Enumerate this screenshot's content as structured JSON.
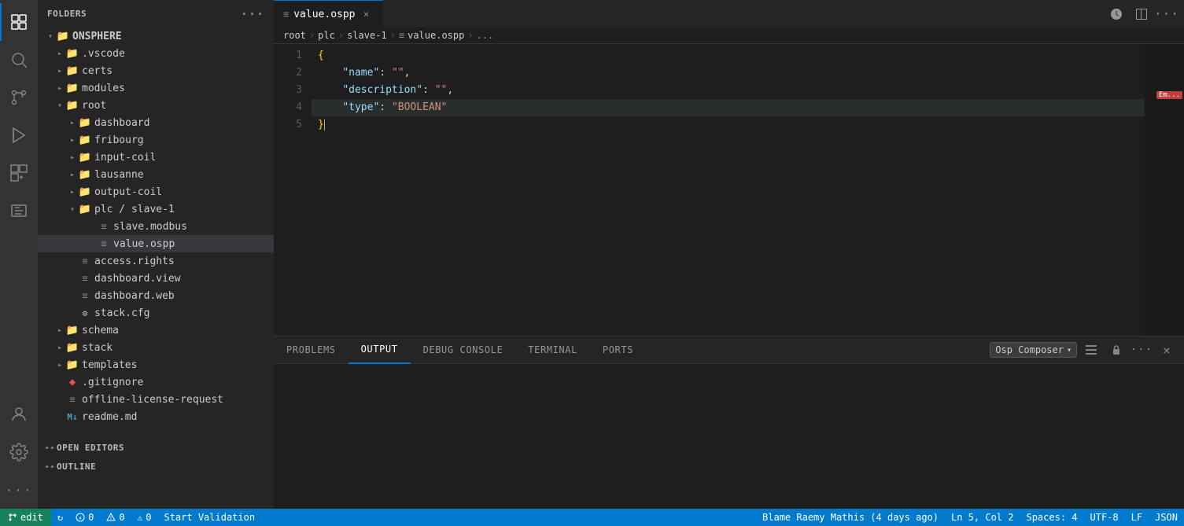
{
  "sidebar": {
    "title": "FOLDERS",
    "root_folder": "ONSPHERE",
    "items": [
      {
        "id": "vscode",
        "label": ".vscode",
        "type": "folder",
        "indent": 1,
        "open": false
      },
      {
        "id": "certs",
        "label": "certs",
        "type": "folder",
        "indent": 1,
        "open": false
      },
      {
        "id": "modules",
        "label": "modules",
        "type": "folder",
        "indent": 1,
        "open": false
      },
      {
        "id": "root",
        "label": "root",
        "type": "folder",
        "indent": 1,
        "open": true
      },
      {
        "id": "dashboard",
        "label": "dashboard",
        "type": "folder",
        "indent": 2,
        "open": false
      },
      {
        "id": "fribourg",
        "label": "fribourg",
        "type": "folder",
        "indent": 2,
        "open": false
      },
      {
        "id": "input-coil",
        "label": "input-coil",
        "type": "folder",
        "indent": 2,
        "open": false
      },
      {
        "id": "lausanne",
        "label": "lausanne",
        "type": "folder",
        "indent": 2,
        "open": false
      },
      {
        "id": "output-coil",
        "label": "output-coil",
        "type": "folder",
        "indent": 2,
        "open": false
      },
      {
        "id": "plc-slave-1",
        "label": "plc / slave-1",
        "type": "folder",
        "indent": 2,
        "open": true
      },
      {
        "id": "slave-modbus",
        "label": "slave.modbus",
        "type": "file-lines",
        "indent": 3,
        "open": false
      },
      {
        "id": "value-ospp",
        "label": "value.ospp",
        "type": "file-lines",
        "indent": 3,
        "open": false,
        "selected": true
      },
      {
        "id": "access-rights",
        "label": "access.rights",
        "type": "file-lines",
        "indent": 2,
        "open": false
      },
      {
        "id": "dashboard-view",
        "label": "dashboard.view",
        "type": "file-lines",
        "indent": 2,
        "open": false
      },
      {
        "id": "dashboard-web",
        "label": "dashboard.web",
        "type": "file-lines",
        "indent": 2,
        "open": false
      },
      {
        "id": "stack-cfg",
        "label": "stack.cfg",
        "type": "file-cfg",
        "indent": 2,
        "open": false
      },
      {
        "id": "schema",
        "label": "schema",
        "type": "folder",
        "indent": 1,
        "open": false
      },
      {
        "id": "stack",
        "label": "stack",
        "type": "folder",
        "indent": 1,
        "open": false
      },
      {
        "id": "templates",
        "label": "templates",
        "type": "folder",
        "indent": 1,
        "open": false
      },
      {
        "id": "gitignore",
        "label": ".gitignore",
        "type": "file-git",
        "indent": 1,
        "open": false
      },
      {
        "id": "offline-license",
        "label": "offline-license-request",
        "type": "file-lines",
        "indent": 1,
        "open": false
      },
      {
        "id": "readme",
        "label": "readme.md",
        "type": "file-md",
        "indent": 1,
        "open": false
      }
    ],
    "open_editors_label": "OPEN EDITORS",
    "outline_label": "OUTLINE"
  },
  "tab": {
    "icon": "≡",
    "filename": "value.ospp",
    "close_icon": "×"
  },
  "breadcrumb": {
    "parts": [
      "root",
      "plc",
      "slave-1",
      "≡ value.ospp",
      "..."
    ]
  },
  "editor": {
    "lines": [
      {
        "num": 1,
        "content": "{",
        "type": "brace"
      },
      {
        "num": 2,
        "content": "    \"name\": \"\",",
        "type": "kv",
        "key": "name",
        "value": ""
      },
      {
        "num": 3,
        "content": "    \"description\": \"\",",
        "type": "kv",
        "key": "description",
        "value": ""
      },
      {
        "num": 4,
        "content": "    \"type\": \"BOOLEAN\"",
        "type": "kv",
        "key": "type",
        "value": "BOOLEAN"
      },
      {
        "num": 5,
        "content": "}",
        "type": "brace"
      }
    ],
    "cursor_line": 5,
    "cursor_col": 2,
    "highlighted_line": 4
  },
  "panel": {
    "tabs": [
      "PROBLEMS",
      "OUTPUT",
      "DEBUG CONSOLE",
      "TERMINAL",
      "PORTS"
    ],
    "active_tab": "OUTPUT",
    "dropdown_label": "Osp Composer",
    "content": ""
  },
  "status_bar": {
    "git_branch": "edit",
    "sync_icon": "↻",
    "errors": "0",
    "warnings": "0",
    "no_problems": "0",
    "start_validation": "Start Validation",
    "blame": "Blame Raemy Mathis (4 days ago)",
    "position": "Ln 5, Col 2",
    "spaces": "Spaces: 4",
    "encoding": "UTF-8",
    "line_ending": "LF",
    "language": "JSON"
  }
}
